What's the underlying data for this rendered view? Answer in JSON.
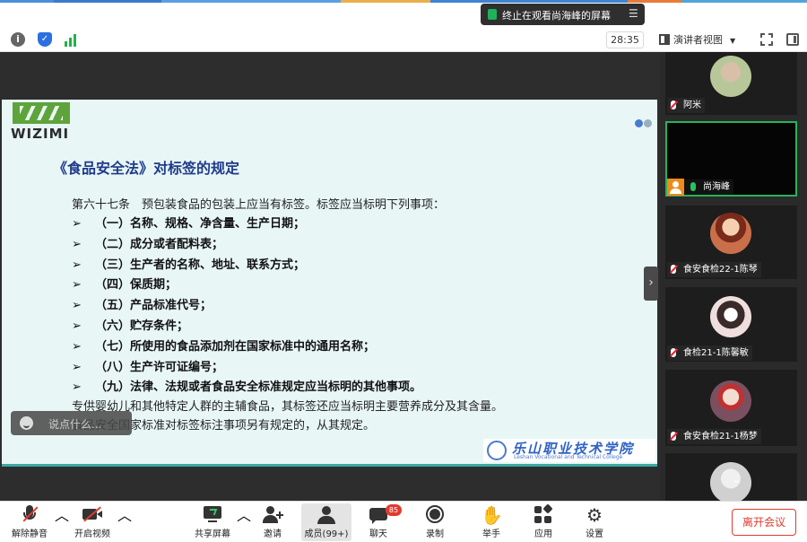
{
  "top_banner": {
    "text": "终止在观看尚海峰的屏幕",
    "menu_icon": "hamburger-icon"
  },
  "toolbar": {
    "timer": "28:35",
    "view_label": "演讲者视图",
    "icons": [
      "info-icon",
      "shield-icon",
      "signal-icon",
      "fullscreen-icon",
      "layout-icon"
    ]
  },
  "slide": {
    "logo_text": "WIZIMI",
    "title": "《食品安全法》对标签的规定",
    "intro": "第六十七条　预包装食品的包装上应当有标签。标签应当标明下列事项：",
    "bullet": "➢",
    "items": [
      "（一）名称、规格、净含量、生产日期；",
      "（二）成分或者配料表；",
      "（三）生产者的名称、地址、联系方式；",
      "（四）保质期；",
      "（五）产品标准代号；",
      "（六）贮存条件；",
      "（七）所使用的食品添加剂在国家标准中的通用名称；",
      "（八）生产许可证编号；",
      "（九）法律、法规或者食品安全标准规定应当标明的其他事项。"
    ],
    "extra_lines": [
      "专供婴幼儿和其他特定人群的主辅食品，其标签还应当标明主要营养成分及其含量。",
      "食品安全国家标准对标签标注事项另有规定的，从其规定。"
    ],
    "college_cn": "乐山职业技术学院",
    "college_en": "Leshan Vocational and Technical College"
  },
  "chat_input": {
    "placeholder": "说点什么..."
  },
  "participants": [
    {
      "name": "阿米",
      "mic": "muted",
      "avatar_color": "#b8c79a"
    },
    {
      "name": "尚海峰",
      "mic": "active",
      "avatar_color": ""
    },
    {
      "name": "食安食检22-1陈琴",
      "mic": "muted",
      "avatar_color": "#c9704a"
    },
    {
      "name": "食检21-1陈馨敏",
      "mic": "muted",
      "avatar_color": "#f0dede"
    },
    {
      "name": "食安食检21-1杨梦",
      "mic": "muted",
      "avatar_color": "#7a5060"
    }
  ],
  "bottom_bar": {
    "unmute": "解除静音",
    "video": "开启视频",
    "share": "共享屏幕",
    "invite": "邀请",
    "members": "成员(99+)",
    "chat": "聊天",
    "chat_badge": "85",
    "record": "录制",
    "raise_hand": "举手",
    "apps": "应用",
    "settings": "设置",
    "leave": "离开会议"
  },
  "colors": {
    "accent_green": "#26b35a",
    "slide_bg": "#e8f6f6",
    "title_blue": "#1f3b8a",
    "leave_red": "#e23a2e"
  }
}
